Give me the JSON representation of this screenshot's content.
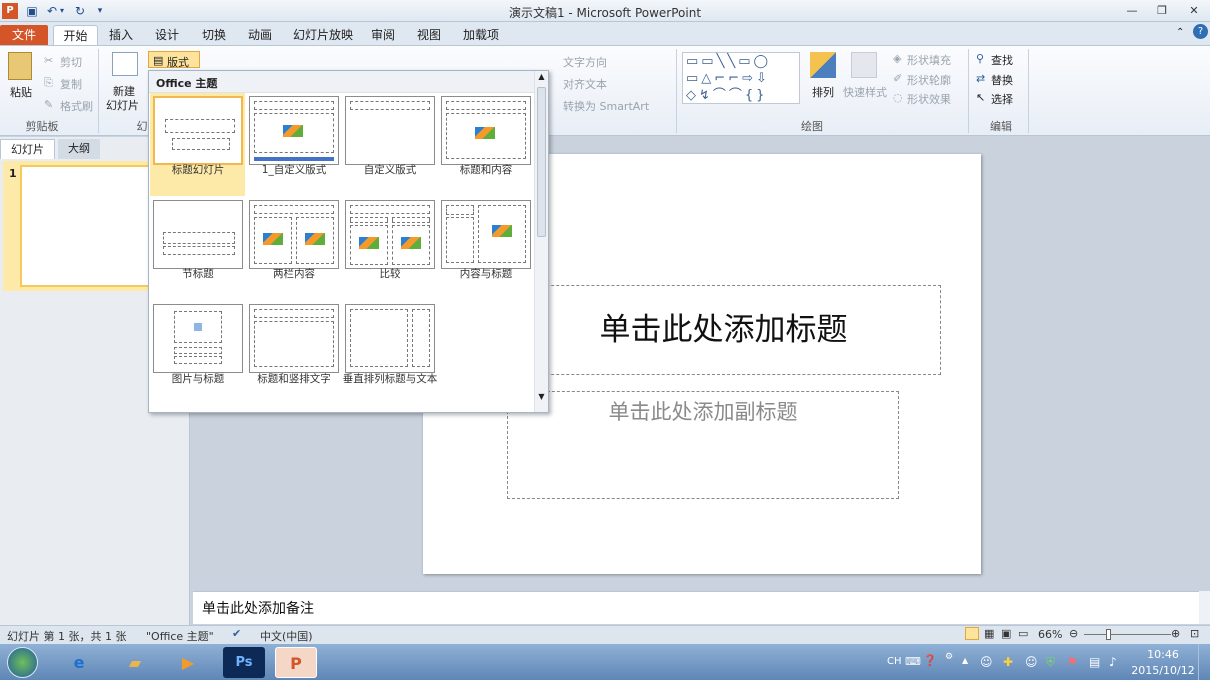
{
  "window": {
    "title": "演示文稿1 - Microsoft PowerPoint"
  },
  "tabs": [
    "文件",
    "开始",
    "插入",
    "设计",
    "切换",
    "动画",
    "幻灯片放映",
    "审阅",
    "视图",
    "加载项"
  ],
  "ribbon": {
    "clipboard": {
      "paste": "粘贴",
      "cut": "剪切",
      "copy": "复制",
      "format_painter": "格式刷",
      "group": "剪贴板"
    },
    "slides": {
      "new_slide_1": "新建",
      "new_slide_2": "幻灯片",
      "layout": "版式",
      "group": "幻"
    },
    "paragraph": {
      "text_direction": "文字方向",
      "align_text": "对齐文本",
      "smartart": "转换为 SmartArt"
    },
    "drawing": {
      "arrange": "排列",
      "quick_styles": "快速样式",
      "shape_fill": "形状填充",
      "shape_outline": "形状轮廓",
      "shape_effects": "形状效果",
      "group": "绘图"
    },
    "editing": {
      "find": "查找",
      "replace": "替换",
      "select": "选择",
      "group": "编辑"
    }
  },
  "layout_gallery": {
    "header": "Office 主题",
    "items": [
      "标题幻灯片",
      "1_自定义版式",
      "自定义版式",
      "标题和内容",
      "节标题",
      "两栏内容",
      "比较",
      "内容与标题",
      "图片与标题",
      "标题和竖排文字",
      "垂直排列标题与文本"
    ]
  },
  "left_pane": {
    "tab_slides": "幻灯片",
    "tab_outline": "大纲",
    "slide_number": "1"
  },
  "slide": {
    "title_placeholder": "单击此处添加标题",
    "subtitle_placeholder": "单击此处添加副标题"
  },
  "notes": {
    "placeholder": "单击此处添加备注"
  },
  "statusbar": {
    "slide_info": "幻灯片 第 1 张，共 1 张",
    "theme": "\"Office 主题\"",
    "language": "中文(中国)",
    "zoom": "66%"
  },
  "taskbar": {
    "ime": "CH",
    "time": "10:46",
    "date": "2015/10/12"
  }
}
